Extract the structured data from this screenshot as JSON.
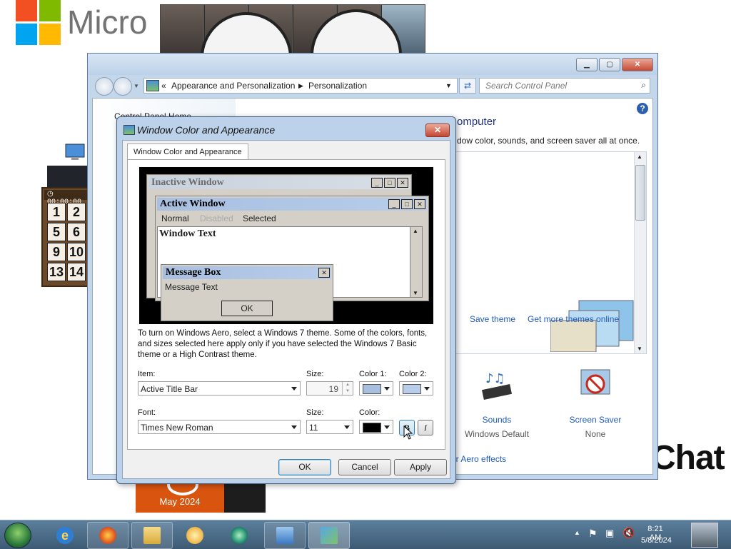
{
  "desktop": {
    "brand_text": "Micro",
    "puzzle_timer": "00:00:00",
    "puzzle_tiles": [
      "1",
      "2",
      "5",
      "6",
      "9",
      "10",
      "13",
      "14"
    ],
    "calendar_label": "May 2024",
    "chat_text": "Chat"
  },
  "control_panel": {
    "address": {
      "chevrons": "«",
      "crumb1": "Appearance and Personalization",
      "crumb2": "Personalization"
    },
    "search_placeholder": "Search Control Panel",
    "left_link": "Control Panel Home",
    "heading_partial": "omputer",
    "desc_partial": "dow color, sounds, and screen saver all at once.",
    "save_theme": "Save theme",
    "get_more_themes": "Get more themes online",
    "sounds_title": "Sounds",
    "sounds_sub": "Windows Default",
    "screensaver_title": "Screen Saver",
    "screensaver_sub": "None",
    "aero_link_partial": "er Aero effects"
  },
  "dialog": {
    "title": "Window Color and Appearance",
    "close_glyph": "✕",
    "tab_label": "Window Color and Appearance",
    "preview": {
      "inactive_title": "Inactive Window",
      "active_title": "Active Window",
      "menu_normal": "Normal",
      "menu_disabled": "Disabled",
      "menu_selected": "Selected",
      "window_text": "Window Text",
      "message_box_title": "Message Box",
      "message_text": "Message Text",
      "ok": "OK"
    },
    "description": "To turn on Windows Aero, select a Windows 7 theme.  Some of the colors, fonts, and sizes selected here apply only if you have selected the Windows 7 Basic theme or a High Contrast theme.",
    "item_label": "Item:",
    "item_value": "Active Title Bar",
    "size_label": "Size:",
    "size_value": "19",
    "color1_label": "Color 1:",
    "color2_label": "Color 2:",
    "color1": "#a9bfe0",
    "color2": "#b8cdea",
    "font_label": "Font:",
    "font_value": "Times New Roman",
    "font_size_label": "Size:",
    "font_size_value": "11",
    "font_color_label": "Color:",
    "font_color": "#000000",
    "bold_label": "B",
    "italic_label": "I",
    "ok": "OK",
    "cancel": "Cancel",
    "apply": "Apply"
  },
  "taskbar": {
    "time": "8:21 AM",
    "date": "5/8/2024",
    "icons": [
      "start-orb",
      "internet-explorer-icon",
      "firefox-icon",
      "file-explorer-icon",
      "media-player-icon",
      "globe-app-icon",
      "control-panel-icon",
      "display-settings-icon"
    ]
  },
  "colors": {
    "accent_blue": "#1f5cc0",
    "dialog_frame": "#bcd2ea",
    "taskbar": "#4a6a86"
  }
}
